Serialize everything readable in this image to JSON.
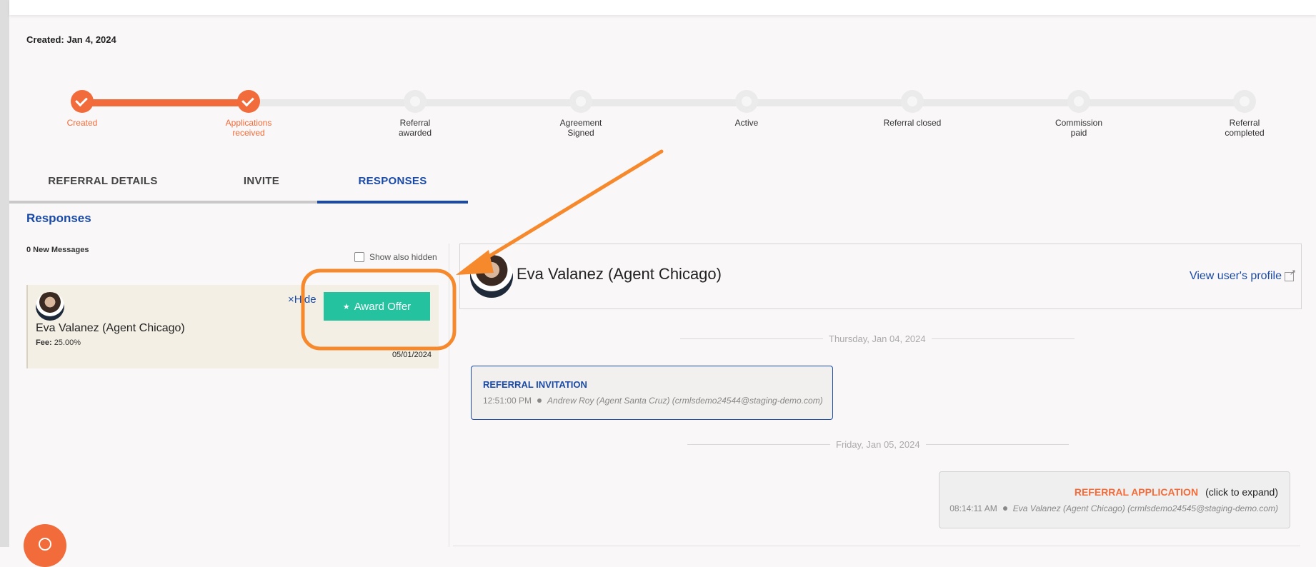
{
  "created_text": "Created: Jan 4, 2024",
  "colors": {
    "accent": "#f26b3a",
    "primary": "#1a4aa8",
    "award": "#25c2a0"
  },
  "stepper": {
    "steps": [
      {
        "label": "Created",
        "status": "done"
      },
      {
        "label": "Applications\nreceived",
        "status": "done"
      },
      {
        "label": "Referral\nawarded",
        "status": "todo"
      },
      {
        "label": "Agreement\nSigned",
        "status": "todo"
      },
      {
        "label": "Active",
        "status": "todo"
      },
      {
        "label": "Referral closed",
        "status": "todo"
      },
      {
        "label": "Commission\npaid",
        "status": "todo"
      },
      {
        "label": "Referral\ncompleted",
        "status": "todo"
      }
    ]
  },
  "tabs": [
    {
      "label": "REFERRAL DETAILS",
      "active": false
    },
    {
      "label": "INVITE",
      "active": false
    },
    {
      "label": "RESPONSES",
      "active": true
    }
  ],
  "responses": {
    "title": "Responses",
    "new_messages": "0 New Messages",
    "show_hidden_label": "Show also hidden",
    "card": {
      "name": "Eva Valanez (Agent Chicago)",
      "fee_label": "Fee:",
      "fee_value": "25.00%",
      "date": "05/01/2024",
      "hide_label": "×Hide",
      "award_label": "Award Offer",
      "award_icon": "star-icon"
    }
  },
  "conversation": {
    "agent_name": "Eva Valanez (Agent Chicago)",
    "view_profile": "View user's profile",
    "days": [
      {
        "label": "Thursday, Jan 04, 2024",
        "message": {
          "title": "REFERRAL INVITATION",
          "time": "12:51:00 PM",
          "sender": "Andrew Roy (Agent Santa Cruz) (crmlsdemo24544@staging-demo.com)"
        }
      },
      {
        "label": "Friday, Jan 05, 2024",
        "message": {
          "title": "REFERRAL APPLICATION",
          "expand": "(click to expand)",
          "time": "08:14:11 AM",
          "sender": "Eva Valanez (Agent Chicago) (crmlsdemo24545@staging-demo.com)"
        }
      }
    ]
  }
}
